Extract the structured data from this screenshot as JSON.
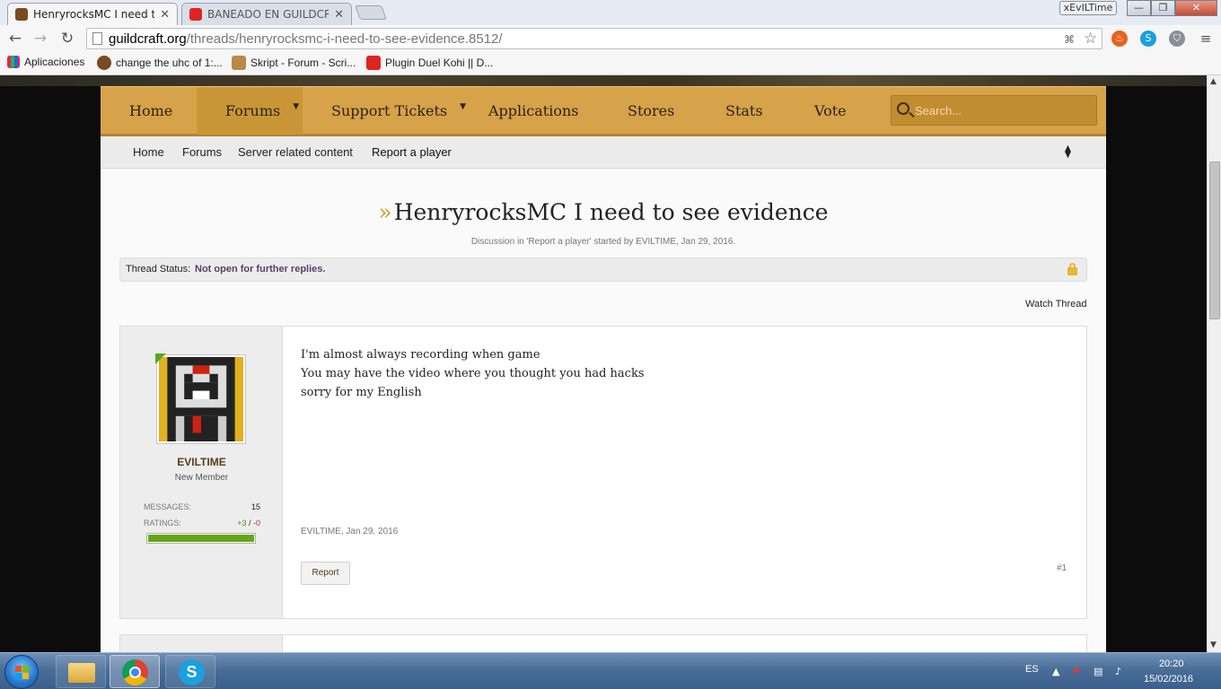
{
  "browser": {
    "tabs": [
      {
        "title": "HenryrocksMC I need to se",
        "active": true
      },
      {
        "title": "BANEADO EN GUILDCRAF",
        "active": false
      }
    ],
    "profile": "xEvILTime",
    "window_controls": {
      "minimize": "—",
      "maximize": "❐",
      "close": "✕"
    },
    "url_host": "guildcraft.org",
    "url_path": "/threads/henryrocksmc-i-need-to-see-evidence.8512/",
    "bookmarks": [
      "Aplicaciones",
      "change the uhc of 1:...",
      "Skript - Forum - Scri...",
      "Plugin Duel Kohi || D..."
    ]
  },
  "site": {
    "nav": {
      "home": "Home",
      "forums": "Forums",
      "support": "Support Tickets",
      "applications": "Applications",
      "stores": "Stores",
      "stats": "Stats",
      "vote": "Vote"
    },
    "search_placeholder": "Search...",
    "breadcrumbs": [
      "Home",
      "Forums",
      "Server related content",
      "Report a player"
    ]
  },
  "thread": {
    "quote_mark": "»",
    "title": "HenryrocksMC I need to see evidence",
    "byline": "Discussion in 'Report a player' started by EVILTIME, Jan 29, 2016.",
    "status_label": "Thread Status:",
    "status_value": "Not open for further replies.",
    "watch": "Watch Thread"
  },
  "post": {
    "username": "EVILTIME",
    "user_title": "New Member",
    "messages_label": "MESSAGES:",
    "messages_value": "15",
    "ratings_label": "RATINGS:",
    "ratings_pos": "+3",
    "ratings_sep": " / ",
    "ratings_neg": "-0",
    "rating_fill": 1.0,
    "lines": [
      "I'm almost always recording when game",
      "You may have the video where you thought you had hacks",
      "sorry for my English"
    ],
    "meta": "EVILTIME, Jan 29, 2016",
    "report": "Report",
    "number": "#1"
  },
  "taskbar": {
    "lang": "ES",
    "time": "20:20",
    "date": "15/02/2016"
  },
  "colors": {
    "nav_gold": "#d6a24a",
    "nav_selected": "#c99637",
    "accent_orange": "#d39a27",
    "status_purple": "#5a3f6a",
    "rating_green": "#66a51b"
  }
}
